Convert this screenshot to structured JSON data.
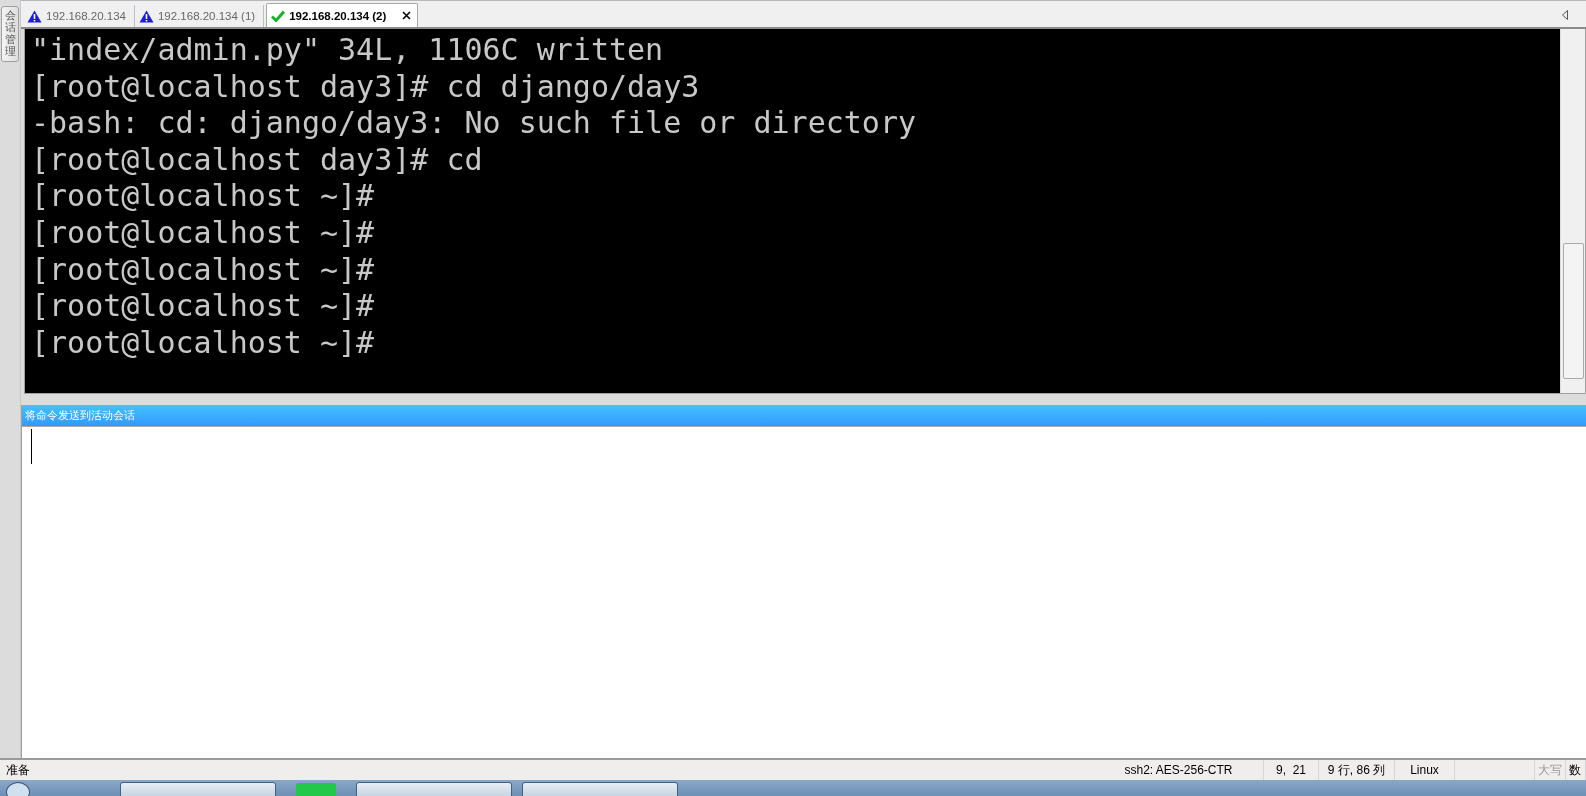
{
  "sidebar": {
    "tab_label": "会话管理"
  },
  "tabs": [
    {
      "label": "192.168.20.134",
      "kind": "warning",
      "selected": false
    },
    {
      "label": "192.168.20.134 (1)",
      "kind": "warning",
      "selected": false
    },
    {
      "label": "192.168.20.134 (2)",
      "kind": "connected",
      "selected": true
    }
  ],
  "terminal": {
    "lines": [
      "\"index/admin.py\" 34L, 1106C written",
      "[root@localhost day3]# cd django/day3",
      "-bash: cd: django/day3: No such file or directory",
      "[root@localhost day3]# cd",
      "[root@localhost ~]#",
      "[root@localhost ~]#",
      "[root@localhost ~]#",
      "[root@localhost ~]#",
      "[root@localhost ~]#"
    ]
  },
  "command_pane": {
    "title": "将命令发送到活动会话"
  },
  "status_bar": {
    "fields": [
      {
        "text": "准备",
        "disabled": false
      },
      {
        "text": "ssh2: AES-256-CTR",
        "disabled": false
      },
      {
        "text": "9,  21",
        "disabled": false
      },
      {
        "text": "9 行, 86 列",
        "disabled": false
      },
      {
        "text": "Linux",
        "disabled": false
      },
      {
        "text": "大写",
        "disabled": true
      },
      {
        "text": "数",
        "disabled": false
      }
    ]
  }
}
